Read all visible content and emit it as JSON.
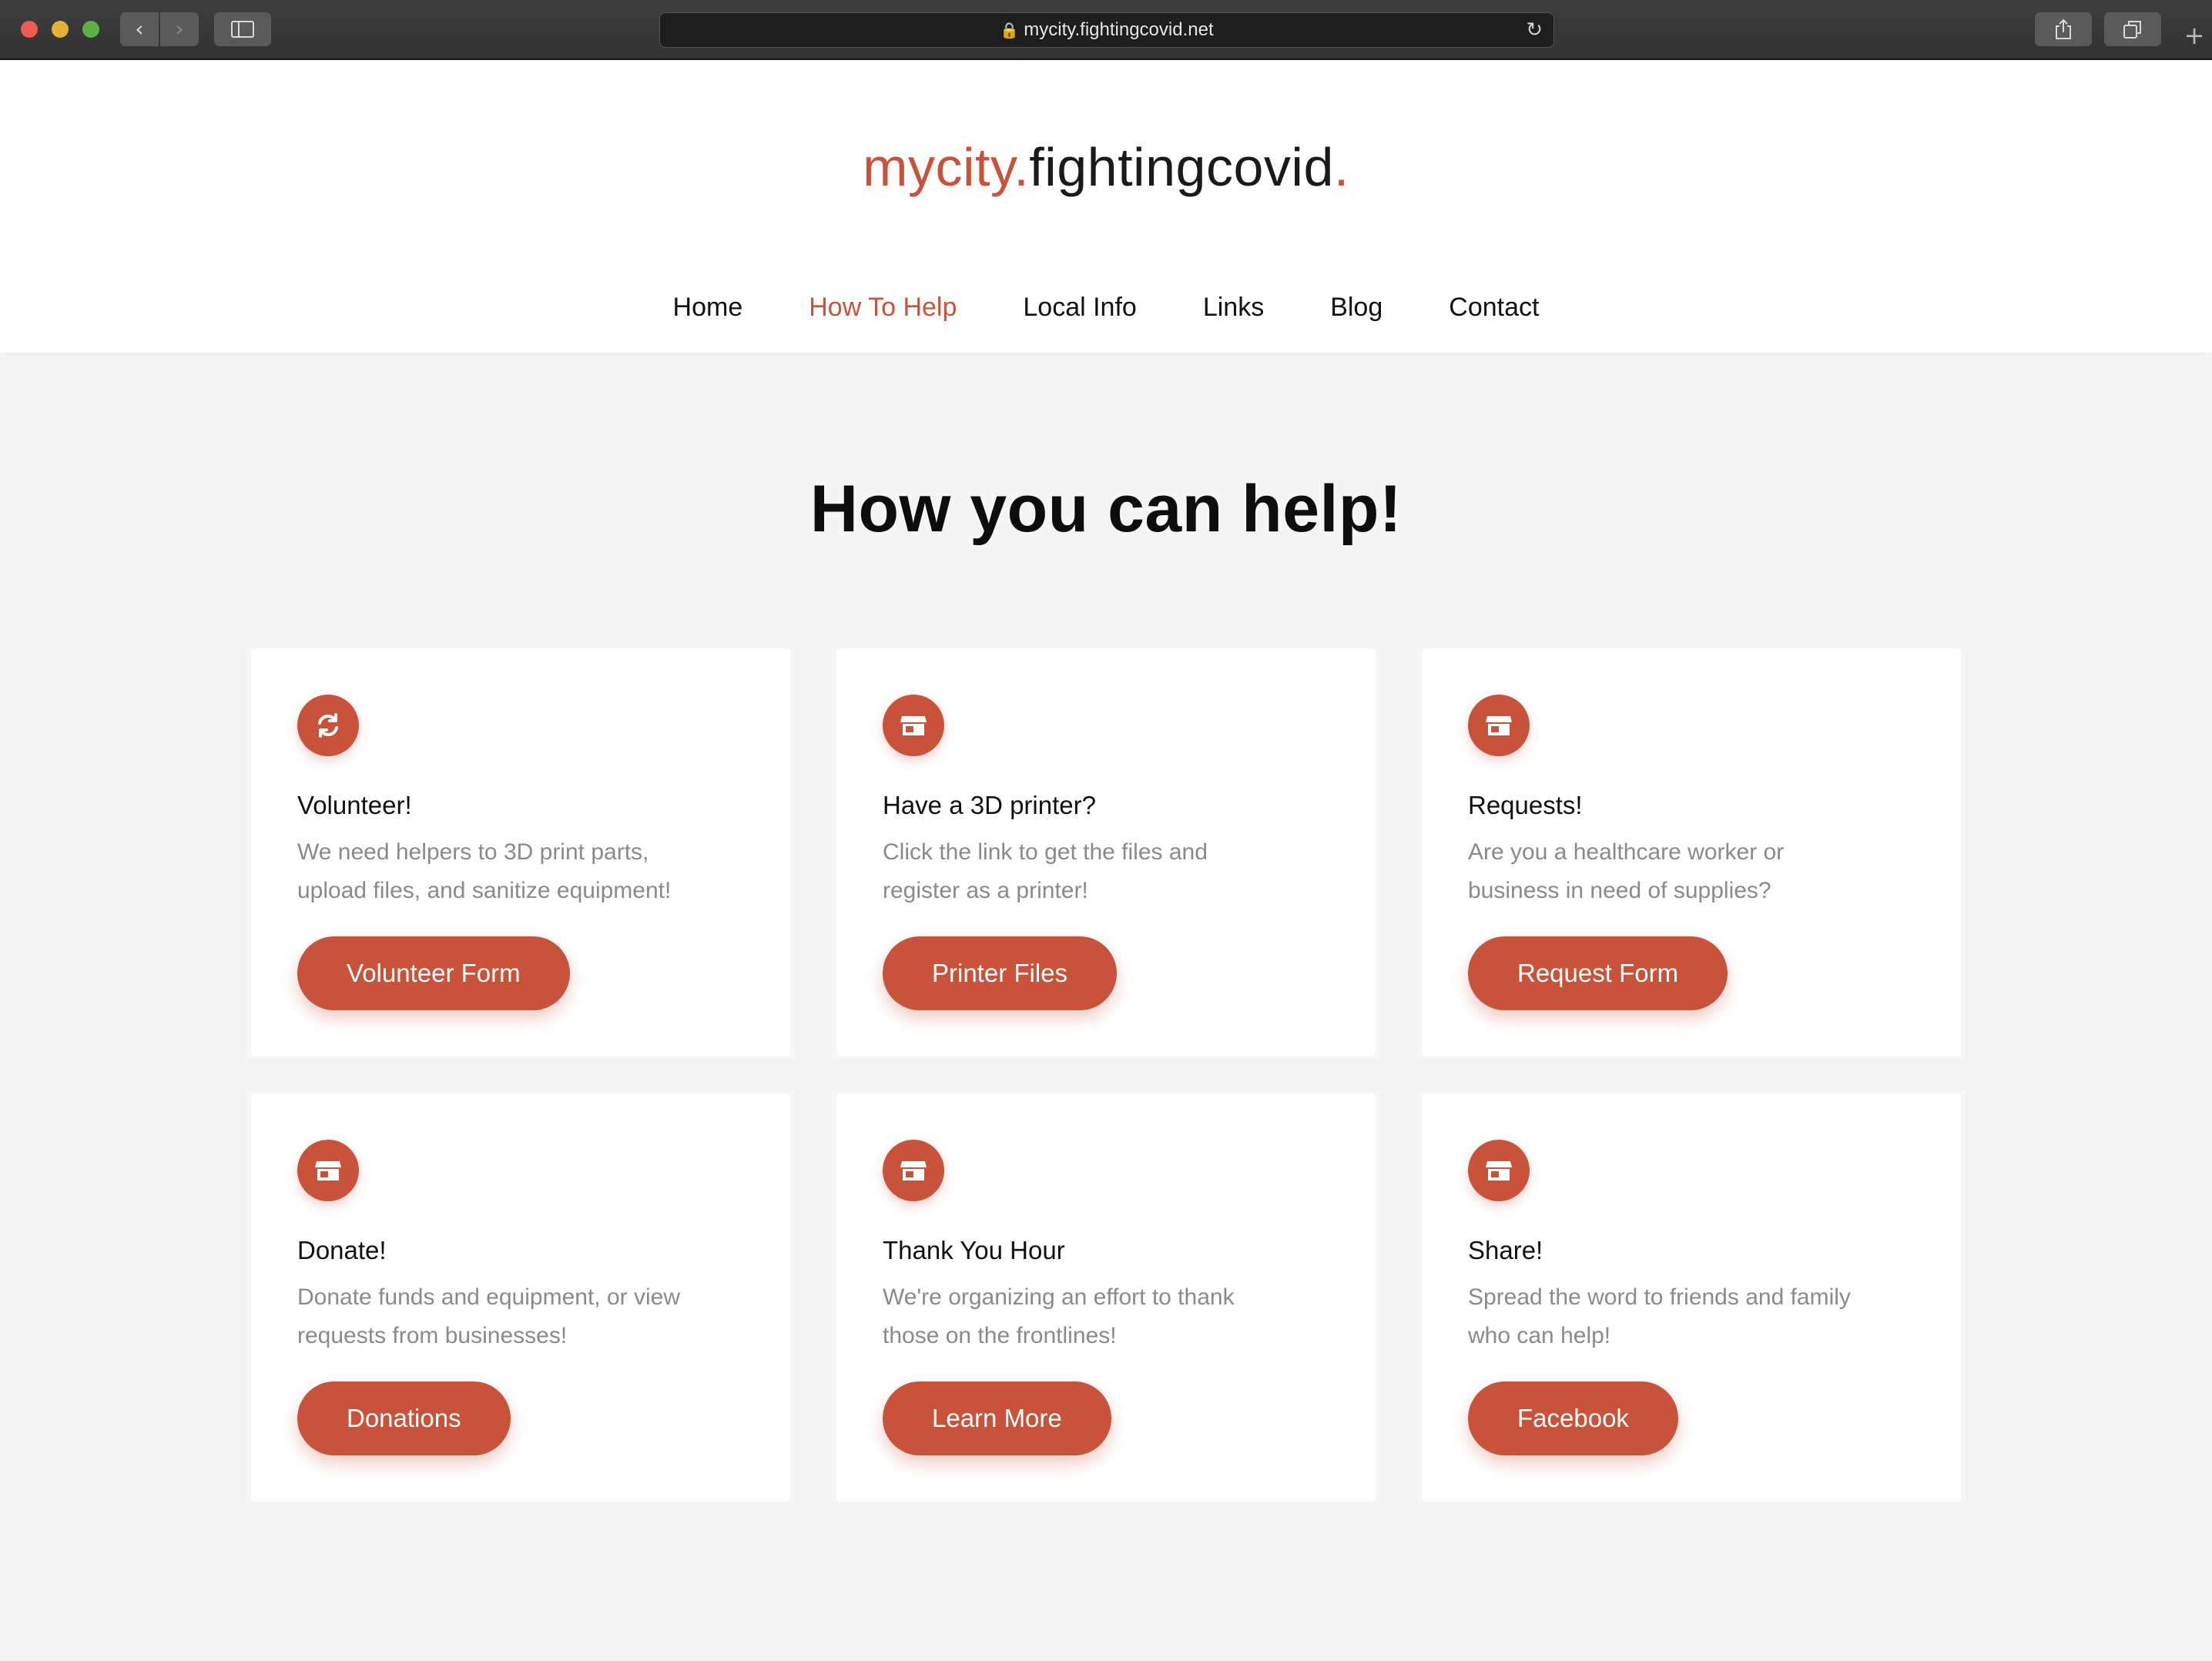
{
  "browser": {
    "url": "mycity.fightingcovid.net"
  },
  "site": {
    "logo_part1": "mycity.",
    "logo_part2": "fightingcovid",
    "logo_part3": "."
  },
  "nav": {
    "items": [
      {
        "label": "Home"
      },
      {
        "label": "How To Help",
        "active": true
      },
      {
        "label": "Local Info"
      },
      {
        "label": "Links"
      },
      {
        "label": "Blog"
      },
      {
        "label": "Contact"
      }
    ]
  },
  "main": {
    "title": "How you can help!",
    "cards": [
      {
        "icon": "refresh-icon",
        "title": "Volunteer!",
        "desc_line1": "We need helpers to 3D print parts,",
        "desc_line2": "upload files, and sanitize equipment!",
        "button": "Volunteer Form"
      },
      {
        "icon": "store-icon",
        "title": "Have a 3D printer?",
        "desc_line1": "Click the link to get the files and",
        "desc_line2": "register as a printer!",
        "button": "Printer Files"
      },
      {
        "icon": "store-icon",
        "title": "Requests!",
        "desc_line1": "Are you a healthcare worker or",
        "desc_line2": "business in need of supplies?",
        "button": "Request Form"
      },
      {
        "icon": "store-icon",
        "title": "Donate!",
        "desc_line1": "Donate funds and equipment, or view",
        "desc_line2": "requests from businesses!",
        "button": "Donations"
      },
      {
        "icon": "store-icon",
        "title": "Thank You Hour",
        "desc_line1": "We're organizing an effort to thank",
        "desc_line2": "those on the frontlines!",
        "button": "Learn More"
      },
      {
        "icon": "store-icon",
        "title": "Share!",
        "desc_line1": "Spread the word to friends and family",
        "desc_line2": "who can help!",
        "button": "Facebook"
      }
    ]
  },
  "colors": {
    "accent": "#c8523a",
    "background": "#f5f5f5",
    "card": "#ffffff",
    "muted_text": "#8a8a8a"
  }
}
